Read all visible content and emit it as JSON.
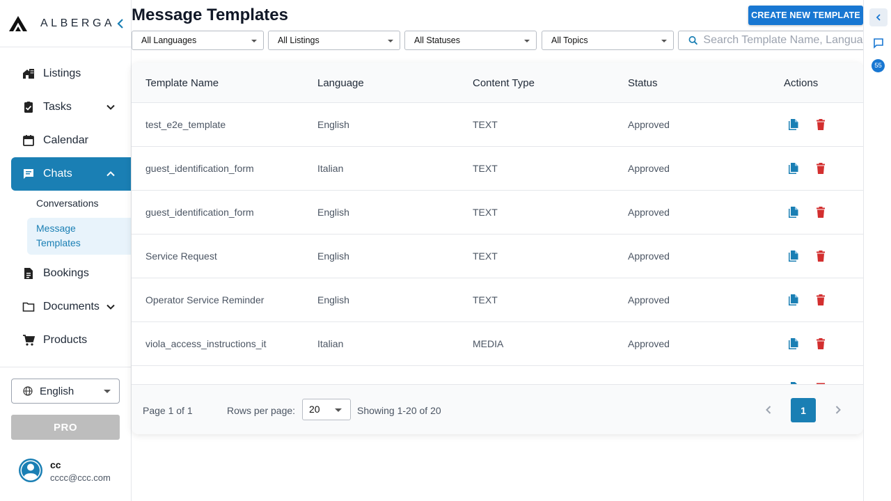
{
  "brand": {
    "name": "ALBERGA"
  },
  "sidebar": {
    "items": [
      {
        "label": "Listings"
      },
      {
        "label": "Tasks"
      },
      {
        "label": "Calendar"
      },
      {
        "label": "Chats"
      },
      {
        "label": "Bookings"
      },
      {
        "label": "Documents"
      },
      {
        "label": "Products"
      }
    ],
    "chats_sub": {
      "conversations": "Conversations",
      "message_templates": "Message Templates"
    },
    "language": "English",
    "pro_label": "PRO",
    "user": {
      "name": "cc",
      "email": "cccc@ccc.com"
    }
  },
  "page": {
    "title": "Message Templates",
    "create_label": "CREATE NEW TEMPLATE"
  },
  "filters": {
    "languages": "All Languages",
    "listings": "All Listings",
    "statuses": "All Statuses",
    "topics": "All Topics",
    "search_placeholder": "Search Template Name, Language"
  },
  "table": {
    "headers": [
      "Template Name",
      "Language",
      "Content Type",
      "Status",
      "Actions"
    ],
    "rows": [
      {
        "name": "test_e2e_template",
        "language": "English",
        "type": "TEXT",
        "status": "Approved"
      },
      {
        "name": "guest_identification_form",
        "language": "Italian",
        "type": "TEXT",
        "status": "Approved"
      },
      {
        "name": "guest_identification_form",
        "language": "English",
        "type": "TEXT",
        "status": "Approved"
      },
      {
        "name": "Service Request",
        "language": "English",
        "type": "TEXT",
        "status": "Approved"
      },
      {
        "name": "Operator Service Reminder",
        "language": "English",
        "type": "TEXT",
        "status": "Approved"
      },
      {
        "name": "viola_access_instructions_it",
        "language": "Italian",
        "type": "MEDIA",
        "status": "Approved"
      }
    ]
  },
  "pagination": {
    "page_text": "Page 1 of 1",
    "rows_label": "Rows per page:",
    "rows_value": "20",
    "showing": "Showing 1-20 of 20",
    "current": "1"
  },
  "rail": {
    "badge": "55"
  },
  "colors": {
    "accent": "#1a7fb4",
    "primary_button": "#1877d2",
    "delete": "#d32f2f"
  }
}
